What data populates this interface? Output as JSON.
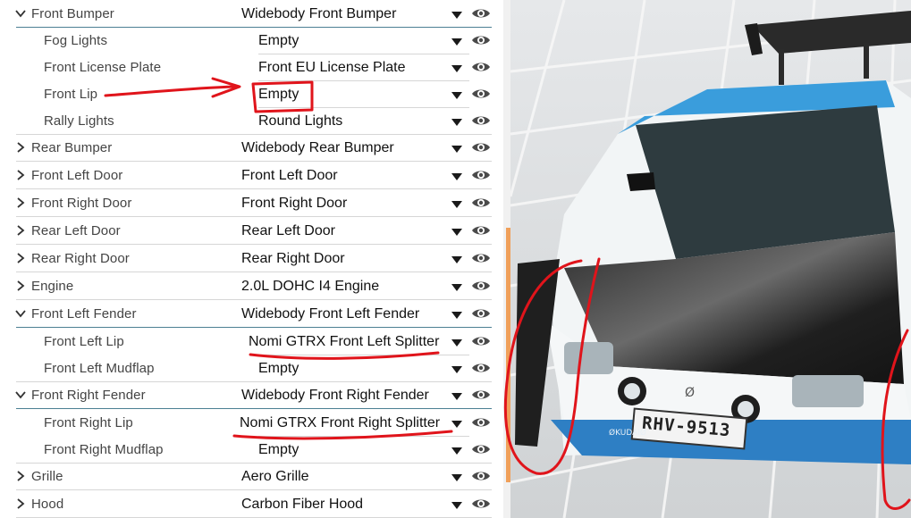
{
  "parts": [
    {
      "label": "Front Bumper",
      "value": "Widebody Front Bumper",
      "expanded": true,
      "level": 0
    },
    {
      "label": "Fog Lights",
      "value": "Empty",
      "level": 1
    },
    {
      "label": "Front License Plate",
      "value": "Front EU License Plate",
      "level": 1
    },
    {
      "label": "Front Lip",
      "value": "Empty",
      "level": 1
    },
    {
      "label": "Rally Lights",
      "value": "Round Lights",
      "level": 1
    },
    {
      "label": "Rear Bumper",
      "value": "Widebody Rear Bumper",
      "expanded": false,
      "level": 0
    },
    {
      "label": "Front Left Door",
      "value": "Front Left Door",
      "expanded": false,
      "level": 0
    },
    {
      "label": "Front Right Door",
      "value": "Front Right Door",
      "expanded": false,
      "level": 0
    },
    {
      "label": "Rear Left Door",
      "value": "Rear Left Door",
      "expanded": false,
      "level": 0
    },
    {
      "label": "Rear Right Door",
      "value": "Rear Right Door",
      "expanded": false,
      "level": 0
    },
    {
      "label": "Engine",
      "value": "2.0L DOHC I4 Engine",
      "expanded": false,
      "level": 0
    },
    {
      "label": "Front Left Fender",
      "value": "Widebody Front Left Fender",
      "expanded": true,
      "level": 0
    },
    {
      "label": "Front Left Lip",
      "value": "Nomi GTRX Front Left Splitter",
      "level": 1
    },
    {
      "label": "Front Left Mudflap",
      "value": "Empty",
      "level": 1
    },
    {
      "label": "Front Right Fender",
      "value": "Widebody Front Right Fender",
      "expanded": true,
      "level": 0
    },
    {
      "label": "Front Right Lip",
      "value": "Nomi GTRX Front Right Splitter",
      "level": 1
    },
    {
      "label": "Front Right Mudflap",
      "value": "Empty",
      "level": 1
    },
    {
      "label": "Grille",
      "value": "Aero Grille",
      "expanded": false,
      "level": 0
    },
    {
      "label": "Hood",
      "value": "Carbon Fiber Hood",
      "expanded": false,
      "level": 0
    }
  ],
  "viewport": {
    "license_plate": "RHV-9513",
    "bumper_brand": "ØKUDAIØ",
    "emblem": "Ø"
  },
  "colors": {
    "annotation_red": "#e0141b",
    "accent_blue": "#4b7f93",
    "scrollbar": "#f0a05a"
  }
}
